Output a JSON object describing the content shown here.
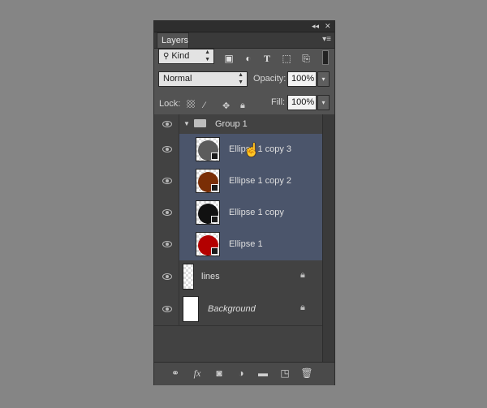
{
  "panel": {
    "tab_label": "Layers",
    "collapse_icon": "double-chevron-left-icon",
    "close_icon": "close-icon",
    "menu_icon": "panel-menu-icon"
  },
  "filter": {
    "kind_label": "Kind",
    "icons": [
      "pixel-filter-icon",
      "adjustment-filter-icon",
      "type-filter-icon",
      "shape-filter-icon",
      "smart-object-filter-icon"
    ]
  },
  "blend": {
    "mode": "Normal",
    "opacity_label": "Opacity:",
    "opacity_value": "100%"
  },
  "lock": {
    "label": "Lock:",
    "fill_label": "Fill:",
    "fill_value": "100%"
  },
  "layers": [
    {
      "name": "Group 1",
      "type": "group",
      "selected": false
    },
    {
      "name": "Ellipse 1 copy 3",
      "type": "shape",
      "color": "#5c5c5c",
      "selected": true
    },
    {
      "name": "Ellipse 1 copy 2",
      "type": "shape",
      "color": "#7a2e06",
      "selected": true
    },
    {
      "name": "Ellipse 1 copy",
      "type": "shape",
      "color": "#111111",
      "selected": true
    },
    {
      "name": "Ellipse 1",
      "type": "shape",
      "color": "#b30000",
      "selected": true
    },
    {
      "name": "lines",
      "type": "pixel",
      "locked": true
    },
    {
      "name": "Background",
      "type": "background",
      "locked": true
    }
  ],
  "bottom_icons": [
    "link-layers-icon",
    "fx-icon",
    "layer-mask-icon",
    "adjustment-layer-icon",
    "new-group-icon",
    "new-layer-icon",
    "trash-icon"
  ]
}
